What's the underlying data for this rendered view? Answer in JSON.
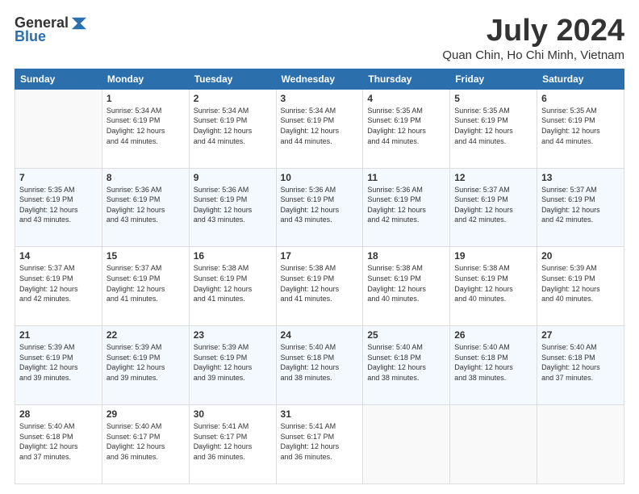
{
  "header": {
    "logo_general": "General",
    "logo_blue": "Blue",
    "month_title": "July 2024",
    "location": "Quan Chin, Ho Chi Minh, Vietnam"
  },
  "days_of_week": [
    "Sunday",
    "Monday",
    "Tuesday",
    "Wednesday",
    "Thursday",
    "Friday",
    "Saturday"
  ],
  "weeks": [
    [
      {
        "num": "",
        "info": ""
      },
      {
        "num": "1",
        "info": "Sunrise: 5:34 AM\nSunset: 6:19 PM\nDaylight: 12 hours\nand 44 minutes."
      },
      {
        "num": "2",
        "info": "Sunrise: 5:34 AM\nSunset: 6:19 PM\nDaylight: 12 hours\nand 44 minutes."
      },
      {
        "num": "3",
        "info": "Sunrise: 5:34 AM\nSunset: 6:19 PM\nDaylight: 12 hours\nand 44 minutes."
      },
      {
        "num": "4",
        "info": "Sunrise: 5:35 AM\nSunset: 6:19 PM\nDaylight: 12 hours\nand 44 minutes."
      },
      {
        "num": "5",
        "info": "Sunrise: 5:35 AM\nSunset: 6:19 PM\nDaylight: 12 hours\nand 44 minutes."
      },
      {
        "num": "6",
        "info": "Sunrise: 5:35 AM\nSunset: 6:19 PM\nDaylight: 12 hours\nand 44 minutes."
      }
    ],
    [
      {
        "num": "7",
        "info": "Sunrise: 5:35 AM\nSunset: 6:19 PM\nDaylight: 12 hours\nand 43 minutes."
      },
      {
        "num": "8",
        "info": "Sunrise: 5:36 AM\nSunset: 6:19 PM\nDaylight: 12 hours\nand 43 minutes."
      },
      {
        "num": "9",
        "info": "Sunrise: 5:36 AM\nSunset: 6:19 PM\nDaylight: 12 hours\nand 43 minutes."
      },
      {
        "num": "10",
        "info": "Sunrise: 5:36 AM\nSunset: 6:19 PM\nDaylight: 12 hours\nand 43 minutes."
      },
      {
        "num": "11",
        "info": "Sunrise: 5:36 AM\nSunset: 6:19 PM\nDaylight: 12 hours\nand 42 minutes."
      },
      {
        "num": "12",
        "info": "Sunrise: 5:37 AM\nSunset: 6:19 PM\nDaylight: 12 hours\nand 42 minutes."
      },
      {
        "num": "13",
        "info": "Sunrise: 5:37 AM\nSunset: 6:19 PM\nDaylight: 12 hours\nand 42 minutes."
      }
    ],
    [
      {
        "num": "14",
        "info": "Sunrise: 5:37 AM\nSunset: 6:19 PM\nDaylight: 12 hours\nand 42 minutes."
      },
      {
        "num": "15",
        "info": "Sunrise: 5:37 AM\nSunset: 6:19 PM\nDaylight: 12 hours\nand 41 minutes."
      },
      {
        "num": "16",
        "info": "Sunrise: 5:38 AM\nSunset: 6:19 PM\nDaylight: 12 hours\nand 41 minutes."
      },
      {
        "num": "17",
        "info": "Sunrise: 5:38 AM\nSunset: 6:19 PM\nDaylight: 12 hours\nand 41 minutes."
      },
      {
        "num": "18",
        "info": "Sunrise: 5:38 AM\nSunset: 6:19 PM\nDaylight: 12 hours\nand 40 minutes."
      },
      {
        "num": "19",
        "info": "Sunrise: 5:38 AM\nSunset: 6:19 PM\nDaylight: 12 hours\nand 40 minutes."
      },
      {
        "num": "20",
        "info": "Sunrise: 5:39 AM\nSunset: 6:19 PM\nDaylight: 12 hours\nand 40 minutes."
      }
    ],
    [
      {
        "num": "21",
        "info": "Sunrise: 5:39 AM\nSunset: 6:19 PM\nDaylight: 12 hours\nand 39 minutes."
      },
      {
        "num": "22",
        "info": "Sunrise: 5:39 AM\nSunset: 6:19 PM\nDaylight: 12 hours\nand 39 minutes."
      },
      {
        "num": "23",
        "info": "Sunrise: 5:39 AM\nSunset: 6:19 PM\nDaylight: 12 hours\nand 39 minutes."
      },
      {
        "num": "24",
        "info": "Sunrise: 5:40 AM\nSunset: 6:18 PM\nDaylight: 12 hours\nand 38 minutes."
      },
      {
        "num": "25",
        "info": "Sunrise: 5:40 AM\nSunset: 6:18 PM\nDaylight: 12 hours\nand 38 minutes."
      },
      {
        "num": "26",
        "info": "Sunrise: 5:40 AM\nSunset: 6:18 PM\nDaylight: 12 hours\nand 38 minutes."
      },
      {
        "num": "27",
        "info": "Sunrise: 5:40 AM\nSunset: 6:18 PM\nDaylight: 12 hours\nand 37 minutes."
      }
    ],
    [
      {
        "num": "28",
        "info": "Sunrise: 5:40 AM\nSunset: 6:18 PM\nDaylight: 12 hours\nand 37 minutes."
      },
      {
        "num": "29",
        "info": "Sunrise: 5:40 AM\nSunset: 6:17 PM\nDaylight: 12 hours\nand 36 minutes."
      },
      {
        "num": "30",
        "info": "Sunrise: 5:41 AM\nSunset: 6:17 PM\nDaylight: 12 hours\nand 36 minutes."
      },
      {
        "num": "31",
        "info": "Sunrise: 5:41 AM\nSunset: 6:17 PM\nDaylight: 12 hours\nand 36 minutes."
      },
      {
        "num": "",
        "info": ""
      },
      {
        "num": "",
        "info": ""
      },
      {
        "num": "",
        "info": ""
      }
    ]
  ]
}
